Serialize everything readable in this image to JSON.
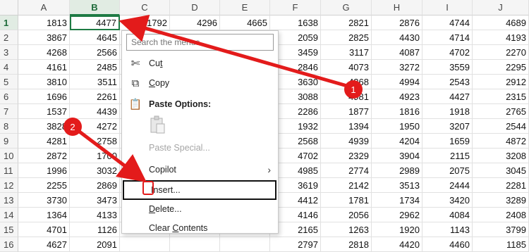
{
  "columns": [
    "A",
    "B",
    "C",
    "D",
    "E",
    "F",
    "G",
    "H",
    "I",
    "J"
  ],
  "selected_column": "B",
  "rows": [
    {
      "n": "1",
      "cells": [
        "1813",
        "4477",
        "1792",
        "4296",
        "4665",
        "1638",
        "2821",
        "2876",
        "4744",
        "4689"
      ]
    },
    {
      "n": "2",
      "cells": [
        "3867",
        "4645",
        "",
        "",
        "",
        "2059",
        "2825",
        "4430",
        "4714",
        "4193"
      ]
    },
    {
      "n": "3",
      "cells": [
        "4268",
        "2566",
        "",
        "",
        "",
        "3459",
        "3117",
        "4087",
        "4702",
        "2270"
      ]
    },
    {
      "n": "4",
      "cells": [
        "4161",
        "2485",
        "",
        "",
        "",
        "2846",
        "4073",
        "3272",
        "3559",
        "2295"
      ]
    },
    {
      "n": "5",
      "cells": [
        "3810",
        "3511",
        "",
        "",
        "",
        "3630",
        "4368",
        "4994",
        "2543",
        "2912"
      ]
    },
    {
      "n": "6",
      "cells": [
        "1696",
        "2261",
        "",
        "",
        "",
        "3088",
        "4981",
        "4923",
        "4427",
        "2315"
      ]
    },
    {
      "n": "7",
      "cells": [
        "1537",
        "4439",
        "",
        "",
        "",
        "2286",
        "1877",
        "1816",
        "1918",
        "2765"
      ]
    },
    {
      "n": "8",
      "cells": [
        "3828",
        "4272",
        "",
        "",
        "",
        "1932",
        "1394",
        "1950",
        "3207",
        "2544"
      ]
    },
    {
      "n": "9",
      "cells": [
        "4281",
        "2758",
        "",
        "",
        "",
        "2568",
        "4939",
        "4204",
        "1659",
        "4872"
      ]
    },
    {
      "n": "10",
      "cells": [
        "2872",
        "1700",
        "",
        "",
        "",
        "4702",
        "2329",
        "3904",
        "2115",
        "3208"
      ]
    },
    {
      "n": "11",
      "cells": [
        "1996",
        "3032",
        "",
        "",
        "",
        "4985",
        "2774",
        "2989",
        "2075",
        "3045"
      ]
    },
    {
      "n": "12",
      "cells": [
        "2255",
        "2869",
        "",
        "",
        "",
        "3619",
        "2142",
        "3513",
        "2444",
        "2281"
      ]
    },
    {
      "n": "13",
      "cells": [
        "3730",
        "3473",
        "",
        "",
        "",
        "4412",
        "1781",
        "1734",
        "3420",
        "3289"
      ]
    },
    {
      "n": "14",
      "cells": [
        "1364",
        "4133",
        "",
        "",
        "",
        "4146",
        "2056",
        "2962",
        "4084",
        "2408"
      ]
    },
    {
      "n": "15",
      "cells": [
        "4701",
        "1126",
        "",
        "",
        "",
        "2165",
        "1263",
        "1920",
        "1143",
        "3799"
      ]
    },
    {
      "n": "16",
      "cells": [
        "4627",
        "2091",
        "",
        "",
        "",
        "2797",
        "2818",
        "4420",
        "4460",
        "1185"
      ]
    }
  ],
  "context_menu": {
    "search_placeholder": "Search the menus",
    "cut": "Cut",
    "copy": "Copy",
    "paste_options": "Paste Options:",
    "paste_special": "Paste Special...",
    "copilot": "Copilot",
    "insert": "Insert...",
    "delete": "Delete...",
    "clear_contents": "Clear Contents"
  },
  "annotations": [
    {
      "label": "1"
    },
    {
      "label": "2"
    }
  ],
  "colors": {
    "annotation_red": "#e31b1b",
    "excel_green": "#1e7b44"
  }
}
